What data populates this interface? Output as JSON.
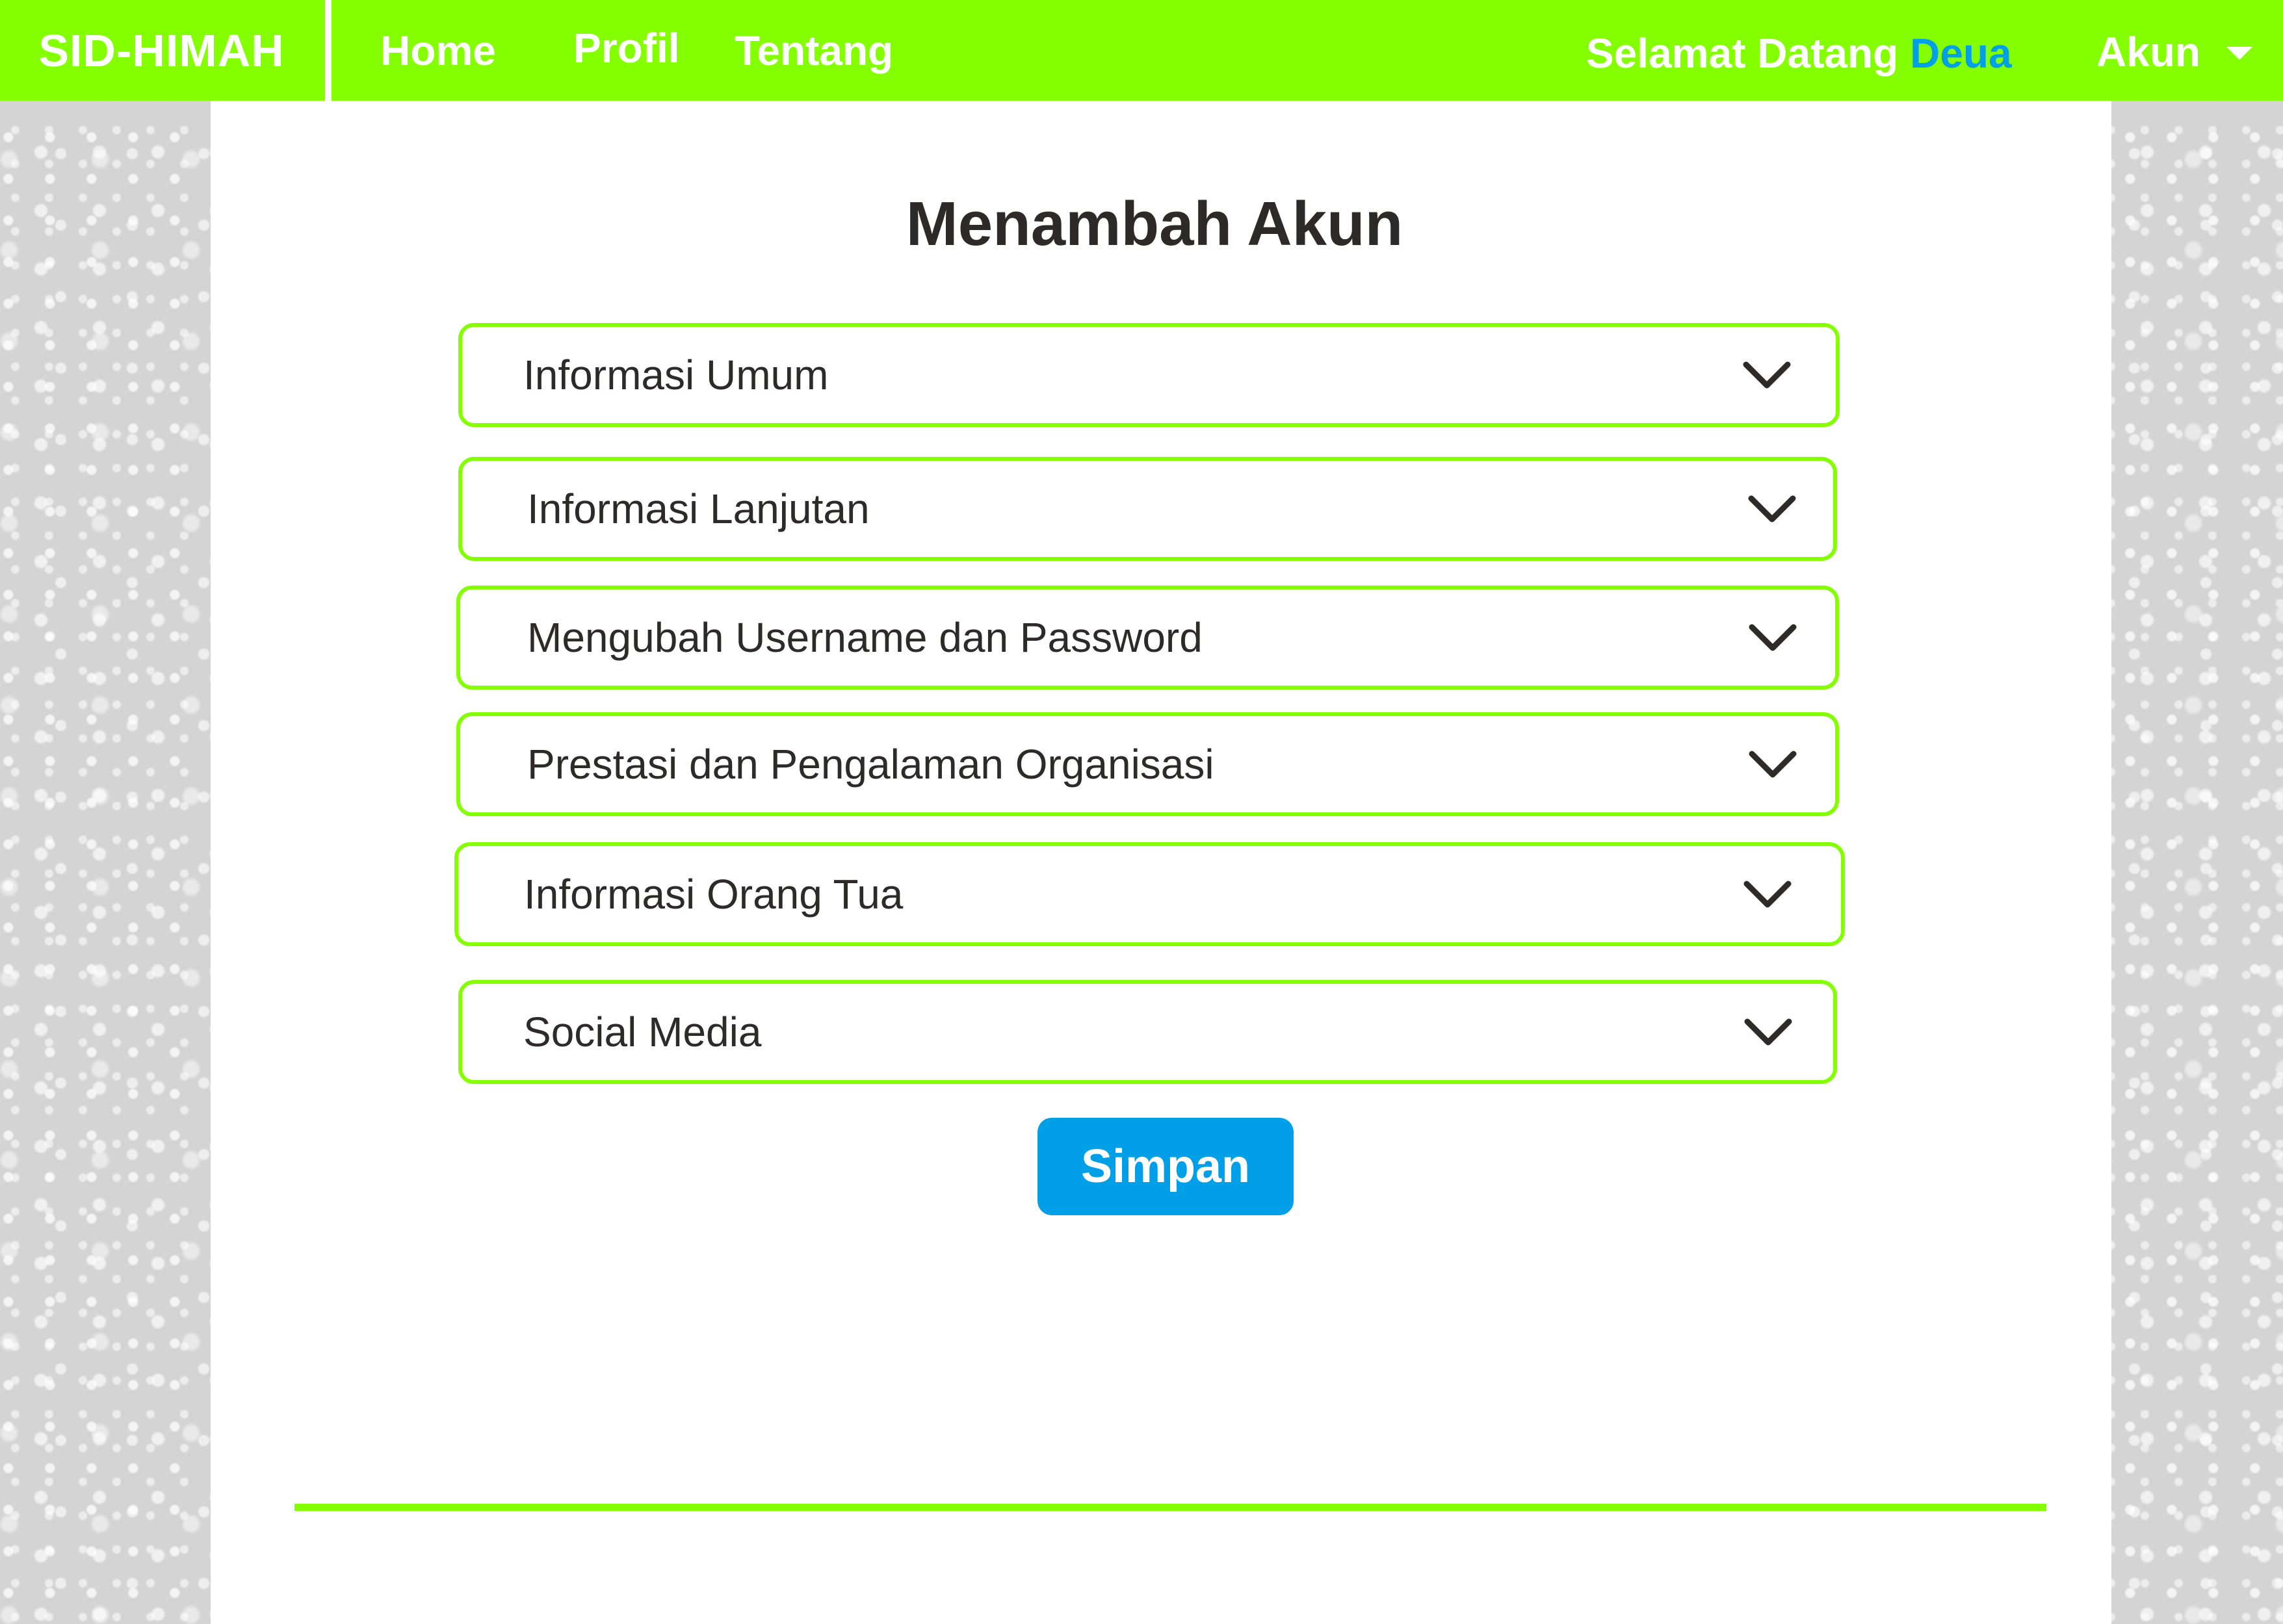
{
  "navbar": {
    "brand": "SID-HIMAH",
    "links": {
      "home": "Home",
      "profil": "Profil",
      "tentang": "Tentang"
    },
    "welcome_text": "Selamat Datang",
    "user_name": "Deua",
    "account_label": "Akun",
    "account_icon": "caret-down-icon"
  },
  "page": {
    "title": "Menambah Akun"
  },
  "accordion": {
    "items": [
      {
        "label": "Informasi Umum",
        "icon": "chevron-down-icon"
      },
      {
        "label": "Informasi Lanjutan",
        "icon": "chevron-down-icon"
      },
      {
        "label": "Mengubah Username dan Password",
        "icon": "chevron-down-icon"
      },
      {
        "label": "Prestasi dan Pengalaman Organisasi",
        "icon": "chevron-down-icon"
      },
      {
        "label": "Informasi Orang Tua",
        "icon": "chevron-down-icon"
      },
      {
        "label": "Social Media",
        "icon": "chevron-down-icon"
      }
    ]
  },
  "actions": {
    "save_label": "Simpan"
  },
  "colors": {
    "navbar_green": "#84ff00",
    "border_green": "#84ff00",
    "accent_blue": "#009fe8",
    "username_blue": "#00a0e9",
    "text_dark": "#2e2a2a",
    "side_pattern_gray": "#d4d4d4"
  }
}
